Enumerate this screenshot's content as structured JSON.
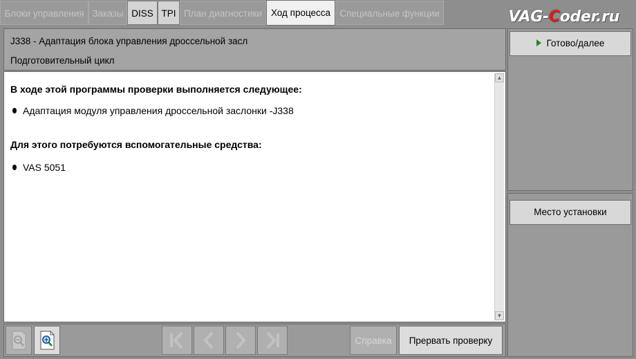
{
  "tabs": [
    {
      "label": "Блоки управления",
      "state": "disabled"
    },
    {
      "label": "Заказы",
      "state": "disabled"
    },
    {
      "label": "DISS",
      "state": "enabled"
    },
    {
      "label": "TPI",
      "state": "enabled"
    },
    {
      "label": "План диагностики",
      "state": "disabled"
    },
    {
      "label": "Ход процесса",
      "state": "active"
    },
    {
      "label": "Специальные функции",
      "state": "disabled"
    }
  ],
  "watermark": {
    "part1": "VAG-",
    "part2": "C",
    "part3": "oder.ru"
  },
  "header": {
    "title": "J338 - Адаптация блока управления дроссельной засл",
    "subtitle": "Подготовительный цикл"
  },
  "content": {
    "heading1": "В ходе этой программы проверки выполняется следующее:",
    "item1": "Адаптация модуля управления дроссельной заслонки -J338",
    "heading2": "Для этого потребуются вспомогательные средства:",
    "item2": "VAS 5051"
  },
  "toolbar": {
    "help_label": "Справка",
    "abort_label": "Прервать проверку"
  },
  "right": {
    "next_label": "Готово/далее",
    "location_label": "Место установки"
  },
  "colors": {
    "watermark_accent": "#e31a1a",
    "play_arrow": "#1f8a1f"
  }
}
